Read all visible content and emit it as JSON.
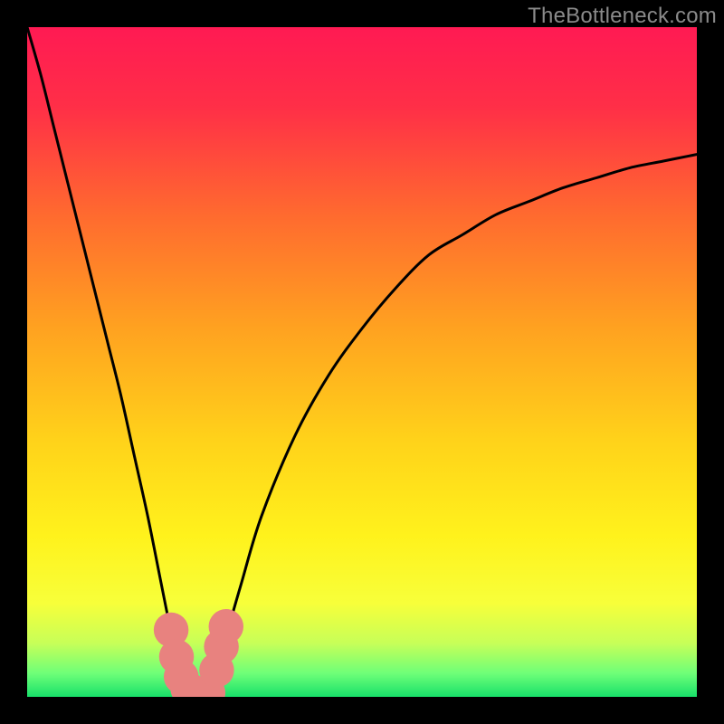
{
  "watermark": {
    "text": "TheBottleneck.com"
  },
  "chart_data": {
    "type": "line",
    "title": "",
    "xlabel": "",
    "ylabel": "",
    "xlim": [
      0,
      100
    ],
    "ylim": [
      0,
      100
    ],
    "gradient_stops": [
      {
        "offset": 0.0,
        "color": "#ff1a53"
      },
      {
        "offset": 0.12,
        "color": "#ff2f47"
      },
      {
        "offset": 0.28,
        "color": "#ff6a2f"
      },
      {
        "offset": 0.45,
        "color": "#ffa220"
      },
      {
        "offset": 0.62,
        "color": "#ffd31a"
      },
      {
        "offset": 0.76,
        "color": "#fff21c"
      },
      {
        "offset": 0.86,
        "color": "#f7ff3a"
      },
      {
        "offset": 0.92,
        "color": "#c7ff58"
      },
      {
        "offset": 0.965,
        "color": "#6eff78"
      },
      {
        "offset": 1.0,
        "color": "#18e06a"
      }
    ],
    "series": [
      {
        "name": "bottleneck-curve",
        "x": [
          0,
          2,
          4,
          6,
          8,
          10,
          12,
          14,
          16,
          18,
          20,
          21,
          22,
          23,
          24,
          25,
          26,
          27,
          28,
          29,
          30,
          32,
          35,
          40,
          45,
          50,
          55,
          60,
          65,
          70,
          75,
          80,
          85,
          90,
          95,
          100
        ],
        "y": [
          100,
          93,
          85,
          77,
          69,
          61,
          53,
          45,
          36,
          27,
          17,
          12,
          7,
          3,
          1,
          0,
          0,
          1,
          3,
          6,
          10,
          17,
          27,
          39,
          48,
          55,
          61,
          66,
          69,
          72,
          74,
          76,
          77.5,
          79,
          80,
          81
        ]
      }
    ],
    "annotations": [
      {
        "name": "marker",
        "x": 21.5,
        "y": 10.0,
        "r": 2.6
      },
      {
        "name": "marker",
        "x": 22.3,
        "y": 6.0,
        "r": 2.6
      },
      {
        "name": "marker",
        "x": 23.0,
        "y": 3.0,
        "r": 2.6
      },
      {
        "name": "marker",
        "x": 24.0,
        "y": 1.2,
        "r": 2.6
      },
      {
        "name": "marker",
        "x": 25.5,
        "y": 0.5,
        "r": 2.6
      },
      {
        "name": "marker",
        "x": 27.0,
        "y": 0.6,
        "r": 2.6
      },
      {
        "name": "marker",
        "x": 28.3,
        "y": 4.0,
        "r": 2.6
      },
      {
        "name": "marker",
        "x": 29.0,
        "y": 7.5,
        "r": 2.6
      },
      {
        "name": "marker",
        "x": 29.7,
        "y": 10.5,
        "r": 2.6
      }
    ],
    "marker_color": "#e8827f"
  }
}
